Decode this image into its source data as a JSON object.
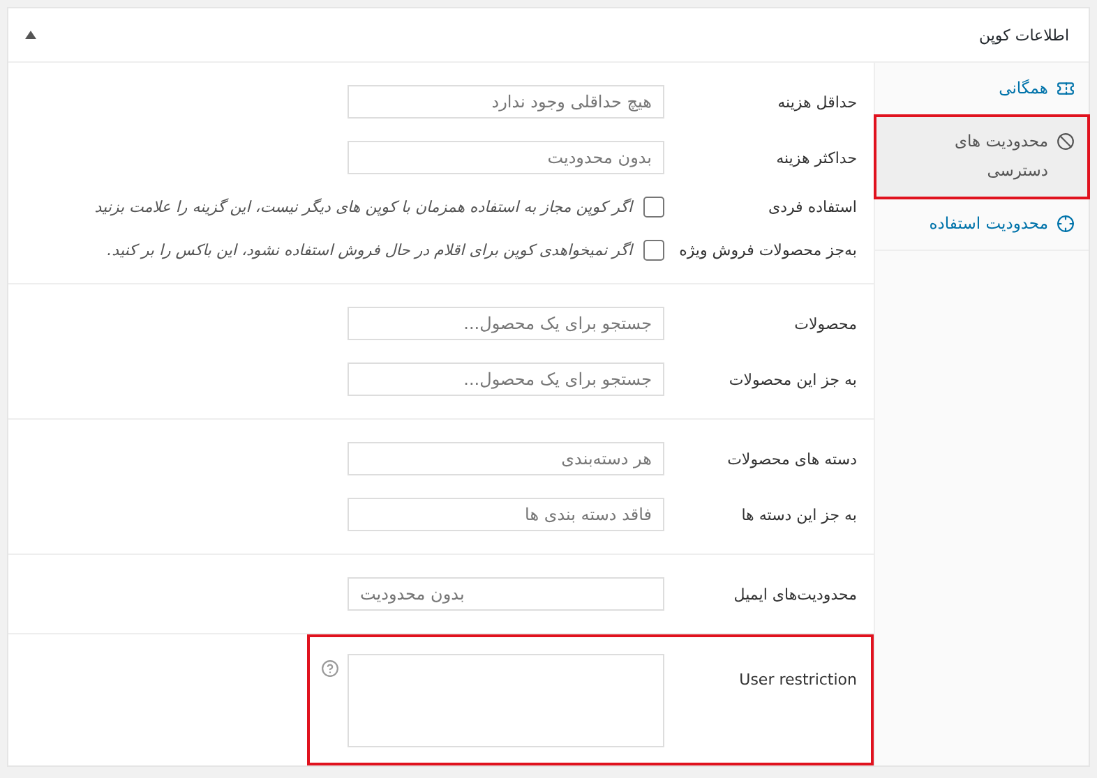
{
  "panel": {
    "title": "اطلاعات کوپن",
    "expanded": true
  },
  "tabs": [
    {
      "label": "همگانی",
      "kind": "ticket",
      "selected": false,
      "highlighted": false
    },
    {
      "label": "محدودیت های دسترسی",
      "kind": "ban",
      "selected": true,
      "highlighted": true
    },
    {
      "label": "محدودیت استفاده",
      "kind": "target",
      "selected": false,
      "highlighted": false
    }
  ],
  "sections": [
    {
      "highlighted": false,
      "fields": [
        {
          "kind": "text",
          "label": "حداقل هزینه",
          "placeholder": "هیچ حداقلی وجود ندارد"
        },
        {
          "kind": "text",
          "label": "حداکثر هزینه",
          "placeholder": "بدون محدودیت"
        },
        {
          "kind": "checkbox",
          "label": "استفاده فردی",
          "checked": false,
          "description": "اگر کوپن مجاز به استفاده همزمان با کوپن های دیگر نیست، این گزینه را علامت بزنید"
        },
        {
          "kind": "checkbox",
          "label": "به‌جز محصولات فروش ویژه",
          "checked": false,
          "description": "اگر نمیخواهدی کوپن برای اقلام در حال فروش استفاده نشود، این باکس را بر کنید."
        }
      ]
    },
    {
      "highlighted": false,
      "fields": [
        {
          "kind": "text",
          "label": "محصولات",
          "placeholder": "جستجو برای یک محصول..."
        },
        {
          "kind": "text",
          "label": "به جز این محصولات",
          "placeholder": "جستجو برای یک محصول..."
        }
      ]
    },
    {
      "highlighted": false,
      "fields": [
        {
          "kind": "text",
          "label": "دسته های محصولات",
          "placeholder": "هر دسته‌بندی"
        },
        {
          "kind": "text",
          "label": "به جز این دسته ها",
          "placeholder": "فاقد دسته بندی ها"
        }
      ]
    },
    {
      "highlighted": false,
      "fields": [
        {
          "kind": "email",
          "label": "محدودیت‌های ایمیل",
          "placeholder": "بدون محدودیت"
        }
      ]
    },
    {
      "highlighted": true,
      "fields": [
        {
          "kind": "textarea",
          "label": "User restriction"
        }
      ]
    }
  ]
}
